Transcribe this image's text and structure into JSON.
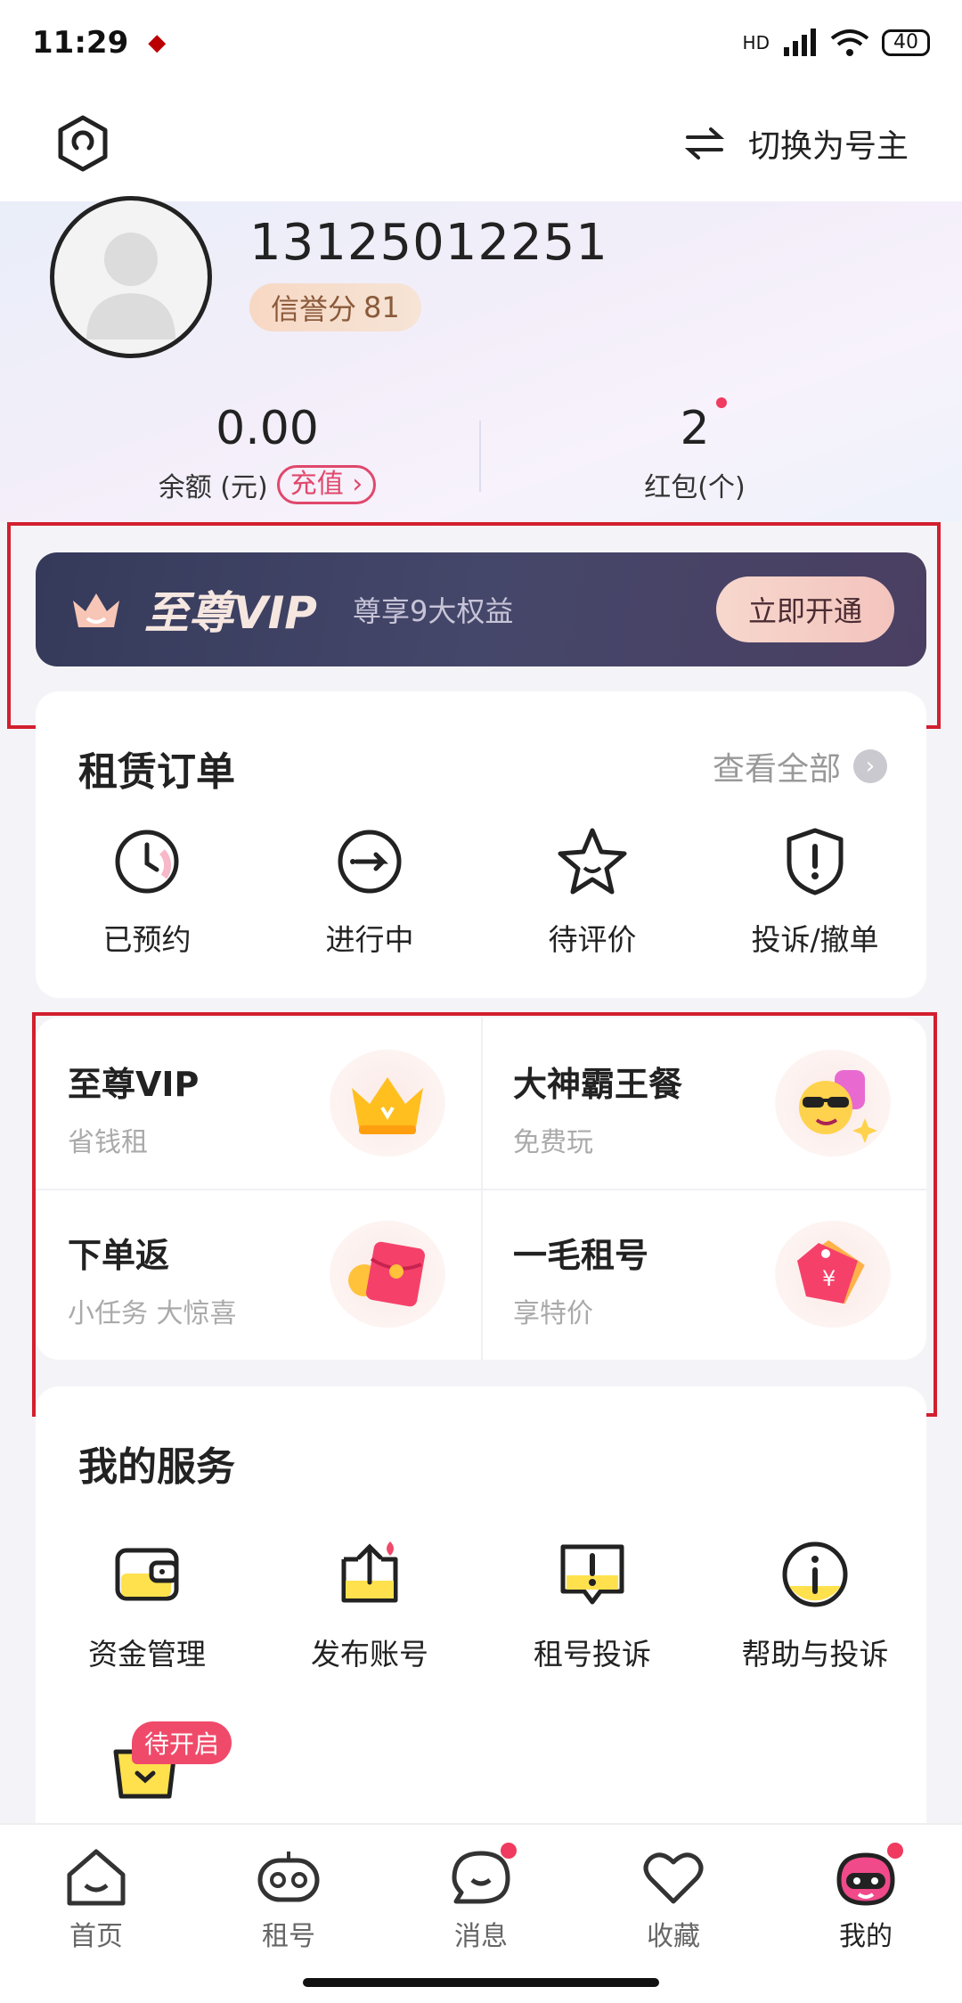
{
  "status_bar": {
    "time": "11:29",
    "network": "HD",
    "battery": "40"
  },
  "top_bar": {
    "switch_label": "切换为号主"
  },
  "profile": {
    "phone": "13125012251",
    "credit_label": "信誉分",
    "credit_score": "81",
    "balance_value": "0.00",
    "balance_label": "余额 (元)",
    "recharge_label": "充值 ›",
    "redpack_value": "2",
    "redpack_label": "红包(个)"
  },
  "vip_banner": {
    "title": "至尊VIP",
    "subtitle": "尊享9大权益",
    "button": "立即开通"
  },
  "orders": {
    "title": "租赁订单",
    "view_all": "查看全部",
    "items": [
      {
        "label": "已预约",
        "icon": "clock-icon"
      },
      {
        "label": "进行中",
        "icon": "arrow-right-circle-icon"
      },
      {
        "label": "待评价",
        "icon": "star-icon"
      },
      {
        "label": "投诉/撤单",
        "icon": "shield-alert-icon"
      }
    ]
  },
  "promos": [
    {
      "title": "至尊VIP",
      "subtitle": "省钱租",
      "icon": "crown-icon"
    },
    {
      "title": "大神霸王餐",
      "subtitle": "免费玩",
      "icon": "cool-face-icon"
    },
    {
      "title": "下单返",
      "subtitle": "小任务 大惊喜",
      "icon": "red-envelope-icon"
    },
    {
      "title": "一毛租号",
      "subtitle": "享特价",
      "icon": "price-tag-icon"
    }
  ],
  "services": {
    "title": "我的服务",
    "items": [
      {
        "label": "资金管理",
        "icon": "wallet-icon"
      },
      {
        "label": "发布账号",
        "icon": "upload-icon"
      },
      {
        "label": "租号投诉",
        "icon": "chat-alert-icon"
      },
      {
        "label": "帮助与投诉",
        "icon": "info-icon"
      }
    ],
    "pending_badge": "待开启"
  },
  "bottom_nav": [
    {
      "label": "首页",
      "icon": "home-icon"
    },
    {
      "label": "租号",
      "icon": "gamepad-icon"
    },
    {
      "label": "消息",
      "icon": "message-icon"
    },
    {
      "label": "收藏",
      "icon": "heart-icon"
    },
    {
      "label": "我的",
      "icon": "profile-mascot-icon"
    }
  ],
  "colors": {
    "accent": "#f04a6a",
    "vip_bg": "#3a3d5e",
    "highlight_box": "#d21f2f"
  }
}
